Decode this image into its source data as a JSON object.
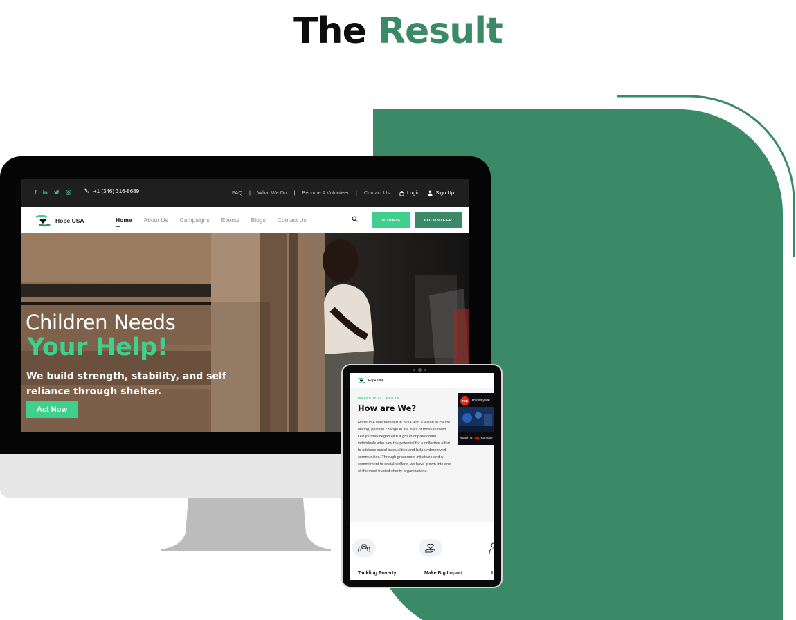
{
  "headline": {
    "word1": "The",
    "word2": "Result"
  },
  "colors": {
    "brand_green": "#3a8a68",
    "accent_green": "#3ed08c",
    "topbar": "#1f1f1f"
  },
  "desktop": {
    "topbar": {
      "social_icons": [
        "facebook-icon",
        "linkedin-icon",
        "twitter-icon",
        "instagram-icon"
      ],
      "social_glyphs": [
        "f",
        "in",
        "•",
        "▣"
      ],
      "phone": "+1 (346) 316-8689",
      "links": [
        "FAQ",
        "What We Do",
        "Become A Volunteer",
        "Contact Us"
      ],
      "login": "Login",
      "signup": "Sign Up"
    },
    "navbar": {
      "brand": "Hope USA",
      "links": [
        "Home",
        "About Us",
        "Campaigns",
        "Events",
        "Blogs",
        "Contact Us"
      ],
      "active": "Home",
      "donate": "DONATE",
      "volunteer": "VOLUNTEER"
    },
    "hero": {
      "line1": "Children Needs",
      "line2": "Your Help!",
      "subtitle": "We build strength, stability, and self reliance through shelter.",
      "cta": "Act Now"
    }
  },
  "tablet": {
    "brand": "Hope USA",
    "eyebrow": "WHERE IT ALL BEGAN",
    "title": "How are We?",
    "body": "HopeUSA was founded in 2024 with a vision to create lasting, positive change in the lives of those in need. Our journey began with a group of passionate individuals who saw the potential for a collective effort to address social inequalities and help underserved communities. Through grassroots initiatives and a commitment to social welfare, we have grown into one of the most trusted charity organizations.",
    "video": {
      "badge": "TED",
      "title": "The way we",
      "watch_on": "Watch on",
      "platform": "YouTube"
    },
    "features": [
      "Tackling Poverty",
      "Make Big Impact"
    ]
  }
}
